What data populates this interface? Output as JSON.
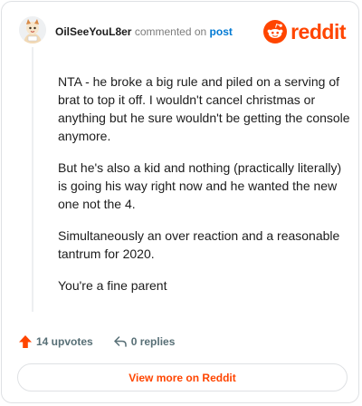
{
  "comment": {
    "username": "OilSeeYouL8er",
    "commented_text": " commented on ",
    "post_link": "post",
    "paragraphs": [
      "NTA - he broke a big rule and piled on a serving of brat to top it off. I wouldn't cancel christmas or anything but he sure wouldn't be getting the console anymore.",
      "But he's also a kid and nothing (practically literally) is going his way right now and he wanted the new one not the 4.",
      "Simultaneously an over reaction and a reasonable tantrum for 2020.",
      "You're a fine parent"
    ]
  },
  "brand": {
    "logo_text": "reddit",
    "accent_color": "#ff4500",
    "link_color": "#0079d3"
  },
  "footer": {
    "upvotes": "14 upvotes",
    "replies": "0 replies",
    "icons": [
      "upvote-arrow-icon",
      "reply-arrow-icon"
    ]
  },
  "view_more_label": "View more on Reddit"
}
